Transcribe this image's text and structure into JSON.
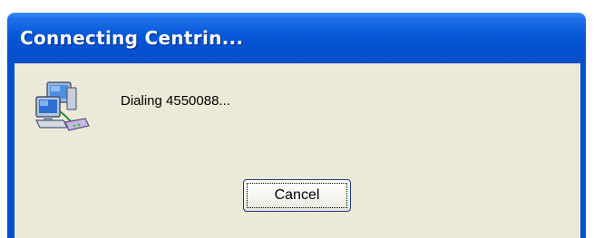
{
  "window": {
    "title": "Connecting Centrin..."
  },
  "dialog": {
    "icon": "network-connection-icon",
    "status_text": "Dialing 4550088...",
    "cancel_label": "Cancel"
  },
  "colors": {
    "titlebar": "#0550cf",
    "client_background": "#ece9d8"
  }
}
